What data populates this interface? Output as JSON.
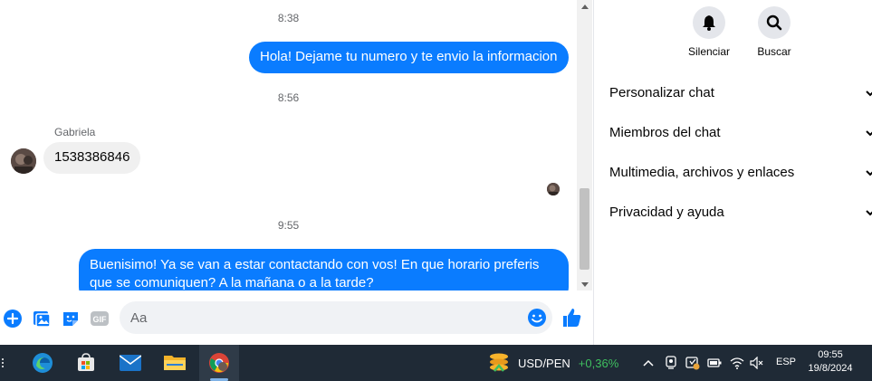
{
  "chat": {
    "timestamps": [
      "8:38",
      "8:56",
      "9:55"
    ],
    "messages": [
      {
        "direction": "out",
        "text": "Hola! Dejame tu numero y te envio la informacion"
      },
      {
        "direction": "in",
        "sender": "Gabriela",
        "text": "1538386846"
      },
      {
        "direction": "out",
        "text": "Buenisimo! Ya se van a estar contactando con vos! En que horario preferis que se comuniquen? A la mañana o a la tarde?"
      }
    ],
    "composer_placeholder": "Aa"
  },
  "panel": {
    "actions": [
      {
        "label": "Silenciar",
        "icon": "bell-icon"
      },
      {
        "label": "Buscar",
        "icon": "search-icon"
      }
    ],
    "sections": [
      "Personalizar chat",
      "Miembros del chat",
      "Multimedia, archivos y enlaces",
      "Privacidad y ayuda"
    ]
  },
  "taskbar": {
    "apps": [
      "edge-icon",
      "store-icon",
      "mail-icon",
      "file-explorer-icon",
      "chrome-icon"
    ],
    "widget": {
      "label": "USD/PEN",
      "change": "+0,36%",
      "change_color": "#3fbf5f"
    },
    "language": "ESP",
    "time": "09:55",
    "date": "19/8/2024"
  },
  "colors": {
    "accent": "#0a7cff",
    "incoming_bubble": "#f0f0f0",
    "taskbar": "#1f2a36"
  }
}
